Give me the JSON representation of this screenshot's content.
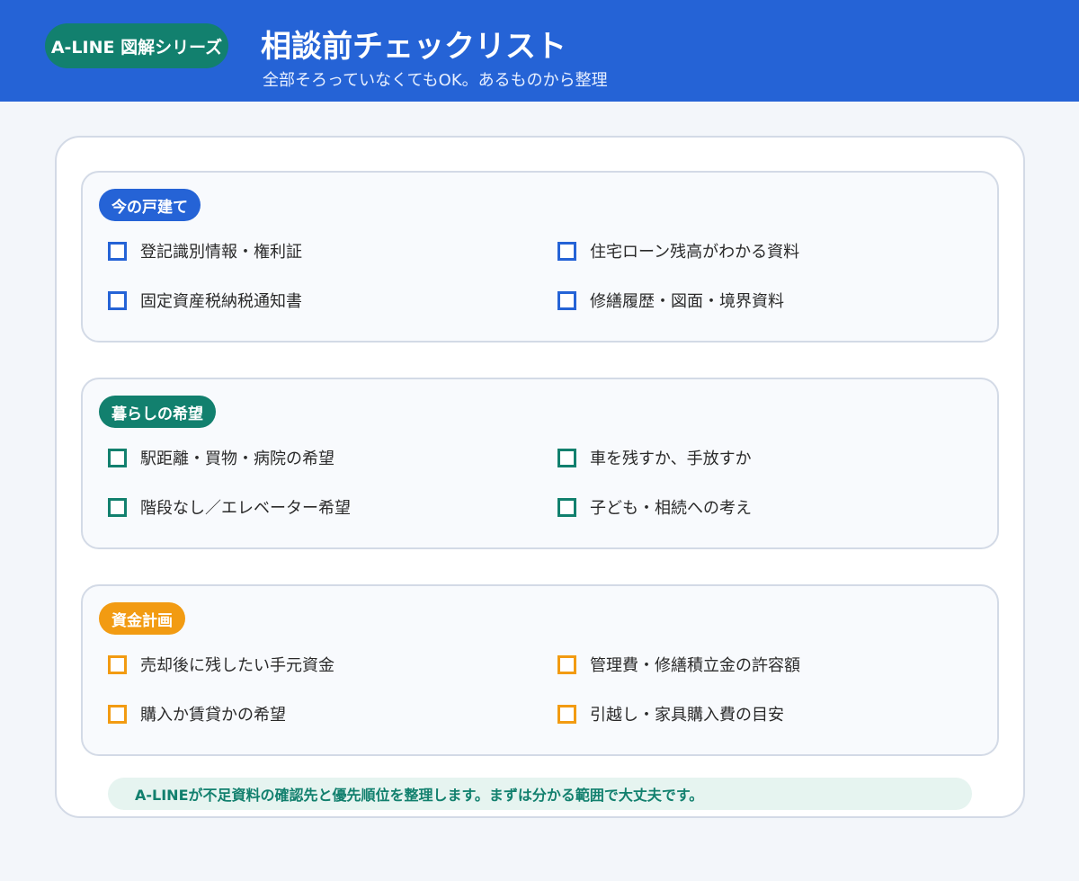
{
  "header": {
    "series_badge": "A-LINE 図解シリーズ",
    "title": "相談前チェックリスト",
    "subtitle": "全部そろっていなくてもOK。あるものから整理"
  },
  "sections": [
    {
      "label": "今の戸建て",
      "color": "#2563d6",
      "items": [
        "登記識別情報・権利証",
        "住宅ローン残高がわかる資料",
        "固定資産税納税通知書",
        "修繕履歴・図面・境界資料"
      ]
    },
    {
      "label": "暮らしの希望",
      "color": "#12806e",
      "items": [
        "駅距離・買物・病院の希望",
        "車を残すか、手放すか",
        "階段なし／エレベーター希望",
        "子ども・相続への考え"
      ]
    },
    {
      "label": "資金計画",
      "color": "#f29b12",
      "items": [
        "売却後に残したい手元資金",
        "管理費・修繕積立金の許容額",
        "購入か賃貸かの希望",
        "引越し・家具購入費の目安"
      ]
    }
  ],
  "footer_note": "A-LINEが不足資料の確認先と優先順位を整理します。まずは分かる範囲で大丈夫です。"
}
